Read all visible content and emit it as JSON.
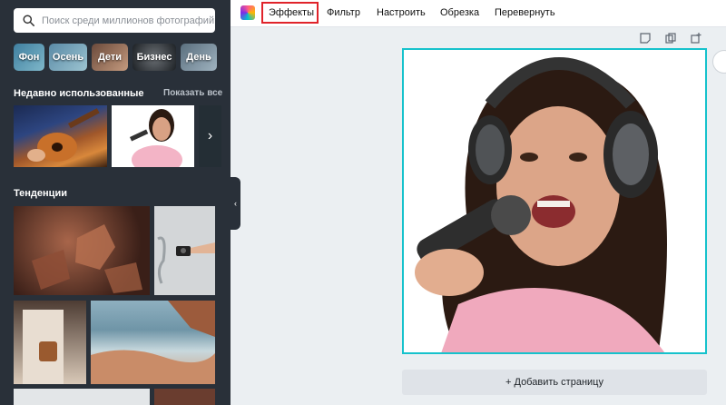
{
  "search": {
    "placeholder": "Поиск среди миллионов фотографий"
  },
  "chips": [
    {
      "label": "Фон",
      "bg": "linear-gradient(135deg,#3f7fa0,#7fb7c9)"
    },
    {
      "label": "Осень",
      "bg": "linear-gradient(135deg,#5a8aa6,#9cc4d1)"
    },
    {
      "label": "Дети",
      "bg": "linear-gradient(135deg,#6b4a3b,#c49a7e)"
    },
    {
      "label": "Бизнес",
      "bg": "radial-gradient(circle at 50% 50%,#6c7176,#1c2024)"
    },
    {
      "label": "День",
      "bg": "linear-gradient(135deg,#5a6f7e,#9fb2bf)"
    }
  ],
  "recent": {
    "title": "Недавно использованные",
    "show_all": "Показать все"
  },
  "trends": {
    "title": "Тенденции"
  },
  "toolbar": {
    "effects": "Эффекты",
    "filter": "Фильтр",
    "adjust": "Настроить",
    "crop": "Обрезка",
    "flip": "Перевернуть"
  },
  "add_page": "+ Добавить страницу",
  "colors": {
    "sidebar": "#293039",
    "canvas_border": "#16c2cc",
    "highlight": "#e0232a"
  }
}
